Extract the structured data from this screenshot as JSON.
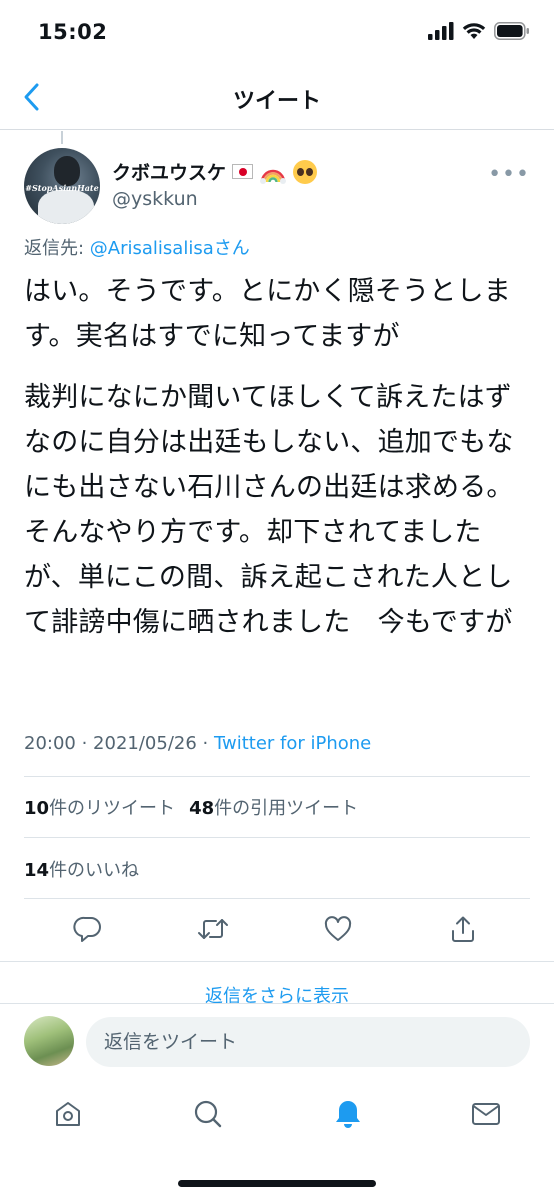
{
  "status_bar": {
    "time": "15:02"
  },
  "nav": {
    "title": "ツイート"
  },
  "tweet": {
    "author": {
      "display_name": "クボユウスケ",
      "handle": "@yskkun",
      "avatar_tag": "#StopAsianHate"
    },
    "reply_to_prefix": "返信先: ",
    "reply_to_mention": "@Arisalisalisaさん",
    "paragraphs": [
      "はい。そうです。とにかく隠そうとします。実名はすでに知ってますが",
      "裁判になにか聞いてほしくて訴えたはずなのに自分は出廷もしない、追加でもなにも出さない石川さんの出廷は求める。そんなやり方です。却下されてましたが、単にこの間、訴え起こされた人として誹謗中傷に晒されました　今もですが"
    ],
    "time": "20:00",
    "date": "2021/05/26",
    "source": "Twitter for iPhone",
    "separator": " · "
  },
  "stats": {
    "retweets_count": "10",
    "retweets_label": "件のリツイート",
    "quotes_count": "48",
    "quotes_label": "件の引用ツイート",
    "likes_count": "14",
    "likes_label": "件のいいね"
  },
  "more_replies_label": "返信をさらに表示",
  "compose": {
    "placeholder": "返信をツイート"
  },
  "icons": {
    "back": "chevron-left-icon",
    "reply": "reply-icon",
    "retweet": "retweet-icon",
    "like": "heart-icon",
    "share": "share-icon",
    "home": "home-icon",
    "search": "search-icon",
    "notifications": "bell-icon",
    "messages": "mail-icon"
  },
  "colors": {
    "accent": "#1d9bf0",
    "text": "#0f1419",
    "secondary_text": "#536471",
    "divider": "#dde3e8",
    "icon_gray": "#536471"
  }
}
